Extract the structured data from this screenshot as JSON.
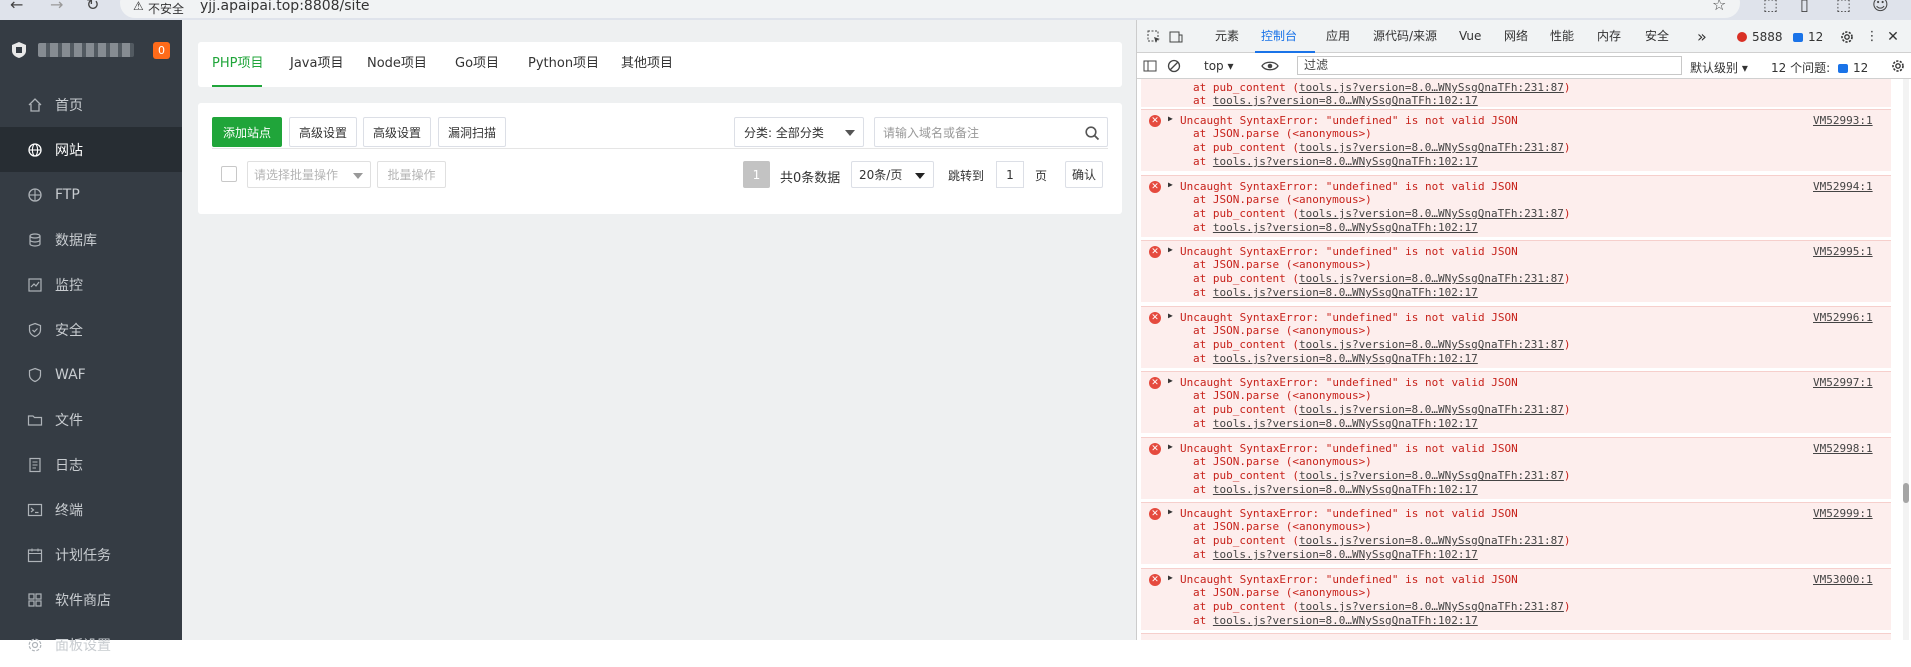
{
  "browser": {
    "security_label": "不安全",
    "url": "yjj.apaipai.top:8808/site"
  },
  "sidebar": {
    "badge": "0",
    "items": [
      {
        "label": "首页",
        "icon": "home-icon"
      },
      {
        "label": "网站",
        "icon": "globe-icon"
      },
      {
        "label": "FTP",
        "icon": "ftp-globe-icon"
      },
      {
        "label": "数据库",
        "icon": "database-icon"
      },
      {
        "label": "监控",
        "icon": "monitor-icon"
      },
      {
        "label": "安全",
        "icon": "shield-icon"
      },
      {
        "label": "WAF",
        "icon": "waf-shield-icon"
      },
      {
        "label": "文件",
        "icon": "folder-icon"
      },
      {
        "label": "日志",
        "icon": "log-icon"
      },
      {
        "label": "终端",
        "icon": "terminal-icon"
      },
      {
        "label": "计划任务",
        "icon": "calendar-icon"
      },
      {
        "label": "软件商店",
        "icon": "store-icon"
      },
      {
        "label": "面板设置",
        "icon": "settings-icon"
      }
    ]
  },
  "main": {
    "tabs": [
      "PHP项目",
      "Java项目",
      "Node项目",
      "Go项目",
      "Python项目",
      "其他项目"
    ],
    "buttons": {
      "add_site": "添加站点",
      "advanced_1": "高级设置",
      "advanced_2": "高级设置",
      "vuln_scan": "漏洞扫描"
    },
    "category_select": "分类: 全部分类",
    "search_placeholder": "请输入域名或备注",
    "batch_select": "请选择批量操作",
    "batch_button": "批量操作",
    "pagination": {
      "current_page": "1",
      "total": "共0条数据",
      "per_page": "20条/页",
      "jump_label": "跳转到",
      "jump_value": "1",
      "page_unit": "页",
      "confirm": "确认"
    }
  },
  "devtools": {
    "tabs": [
      "元素",
      "控制台",
      "应用",
      "源代码/来源",
      "Vue",
      "网络",
      "性能",
      "内存",
      "安全"
    ],
    "more": "»",
    "error_count": "5888",
    "message_count": "12",
    "context": "top",
    "filter_placeholder": "过滤",
    "level": "默认级别",
    "issues_label": "12 个问题:",
    "issues_count": "12",
    "partial_top": {
      "line1": "at pub_content (",
      "line1_link": "tools.js?version=8.0…WNySsgQnaTFh:231:87",
      "line2": "at ",
      "line2_link": "tools.js?version=8.0…WNySsgQnaTFh:102:17"
    },
    "error": {
      "message": "Uncaught SyntaxError: \"undefined\" is not valid JSON",
      "parse_line": "at JSON.parse (<anonymous>)",
      "pub_prefix": "at pub_content (",
      "pub_link": "tools.js?version=8.0…WNySsgQnaTFh:231:87",
      "pub_suffix": ")",
      "tools_prefix": "at ",
      "tools_link": "tools.js?version=8.0…WNySsgQnaTFh:102:17"
    },
    "sources": [
      "VM52993:1",
      "VM52994:1",
      "VM52995:1",
      "VM52996:1",
      "VM52997:1",
      "VM52998:1",
      "VM52999:1",
      "VM53000:1"
    ]
  }
}
